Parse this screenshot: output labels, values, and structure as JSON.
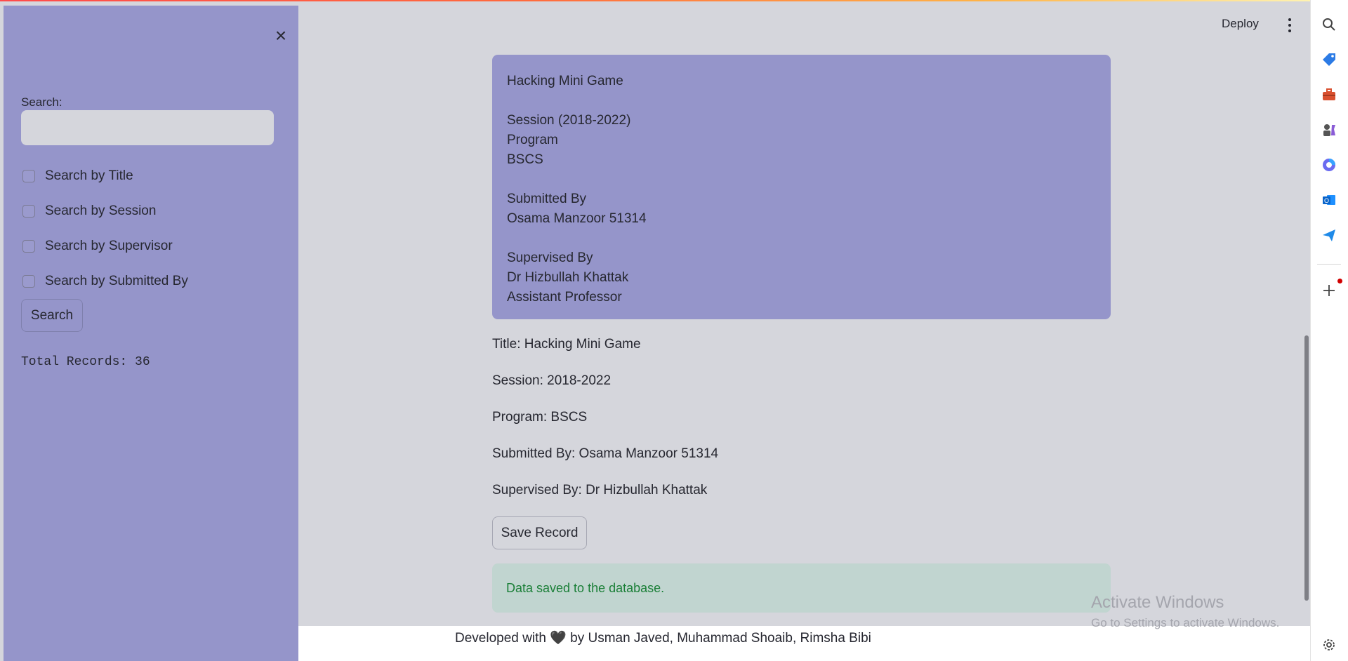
{
  "sidebar": {
    "close_icon": "×",
    "search_label": "Search:",
    "search_value": "",
    "checkboxes": [
      {
        "label": "Search by Title",
        "checked": false
      },
      {
        "label": "Search by Session",
        "checked": false
      },
      {
        "label": "Search by Supervisor",
        "checked": false
      },
      {
        "label": "Search by Submitted By",
        "checked": false
      }
    ],
    "search_button": "Search",
    "total_records": "Total Records: 36"
  },
  "header": {
    "deploy_label": "Deploy"
  },
  "main": {
    "textarea_content": "Hacking Mini Game\n\nSession (2018-2022)\nProgram\nBSCS\n\nSubmitted By\nOsama Manzoor 51314\n\nSupervised By\nDr Hizbullah Khattak\nAssistant Professor",
    "title_line": "Title: Hacking Mini Game",
    "session_line": "Session: 2018-2022",
    "program_line": "Program: BSCS",
    "submitted_line": "Submitted By: Osama Manzoor 51314",
    "supervised_line": "Supervised By: Dr Hizbullah Khattak",
    "save_button": "Save Record",
    "success_message": "Data saved to the database."
  },
  "footer": {
    "text": "Developed with 🖤 by Usman Javed, Muhammad Shoaib, Rimsha Bibi"
  },
  "watermark": {
    "title": "Activate Windows",
    "subtitle": "Go to Settings to activate Windows."
  },
  "right_rail": {
    "icons": [
      "search-icon",
      "tag-icon",
      "toolbox-icon",
      "chess-icon",
      "copilot-icon",
      "outlook-icon",
      "send-icon",
      "add-icon",
      "settings-icon"
    ]
  },
  "colors": {
    "sidebar": "#9595ca",
    "background": "#d5d6dc",
    "success_bg": "#c1d5d0",
    "success_text": "#1a7f37"
  }
}
